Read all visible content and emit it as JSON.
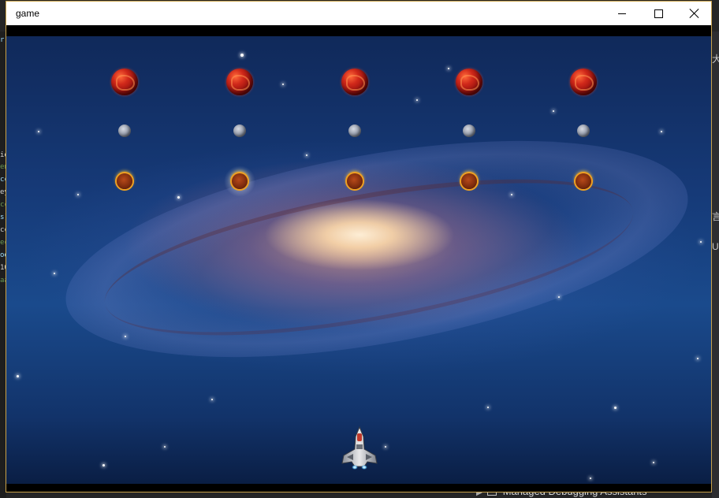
{
  "window": {
    "title": "game"
  },
  "controls": {
    "minimize": "minimize",
    "maximize": "maximize",
    "close": "close"
  },
  "game": {
    "enemy_rows": [
      {
        "type": "large-red-asteroid",
        "count": 5
      },
      {
        "type": "small-gray-asteroid",
        "count": 5
      },
      {
        "type": "flaming-meteor",
        "count": 5
      }
    ],
    "player": "spaceship",
    "background": "spiral-galaxy"
  },
  "ide_background": {
    "bottom_item": "Managed Debugging Assistants",
    "right_chars": [
      "大",
      "言",
      "U"
    ],
    "left_fragments": [
      "r.",
      "ie",
      "en",
      "cc",
      "ey",
      "cc",
      "s]",
      "cc",
      "ec",
      "oe",
      "10",
      "aa"
    ]
  },
  "colors": {
    "window_border": "#c9a24a",
    "titlebar": "#ffffff",
    "space_deep": "#10295a",
    "galaxy_core": "#fff0d7"
  }
}
